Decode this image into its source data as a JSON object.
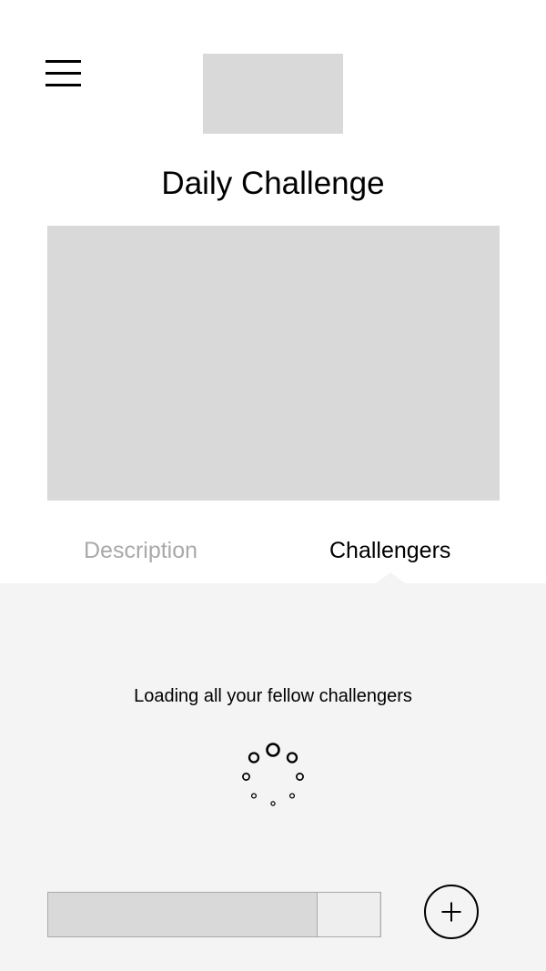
{
  "header": {
    "menu_icon": "hamburger-menu-icon",
    "logo": "logo-placeholder"
  },
  "page": {
    "title": "Daily Challenge"
  },
  "tabs": [
    {
      "label": "Description",
      "active": false
    },
    {
      "label": "Challengers",
      "active": true
    }
  ],
  "panel": {
    "loading_text": "Loading all your fellow challengers",
    "spinner_icon": "loading-spinner-icon"
  },
  "footer": {
    "input_placeholder": "",
    "submit_label": "",
    "add_icon": "plus-icon"
  },
  "colors": {
    "placeholder_gray": "#d9d9d9",
    "panel_background": "#f4f4f4",
    "inactive_tab": "#a9a9a9",
    "active_tab": "#000000"
  }
}
